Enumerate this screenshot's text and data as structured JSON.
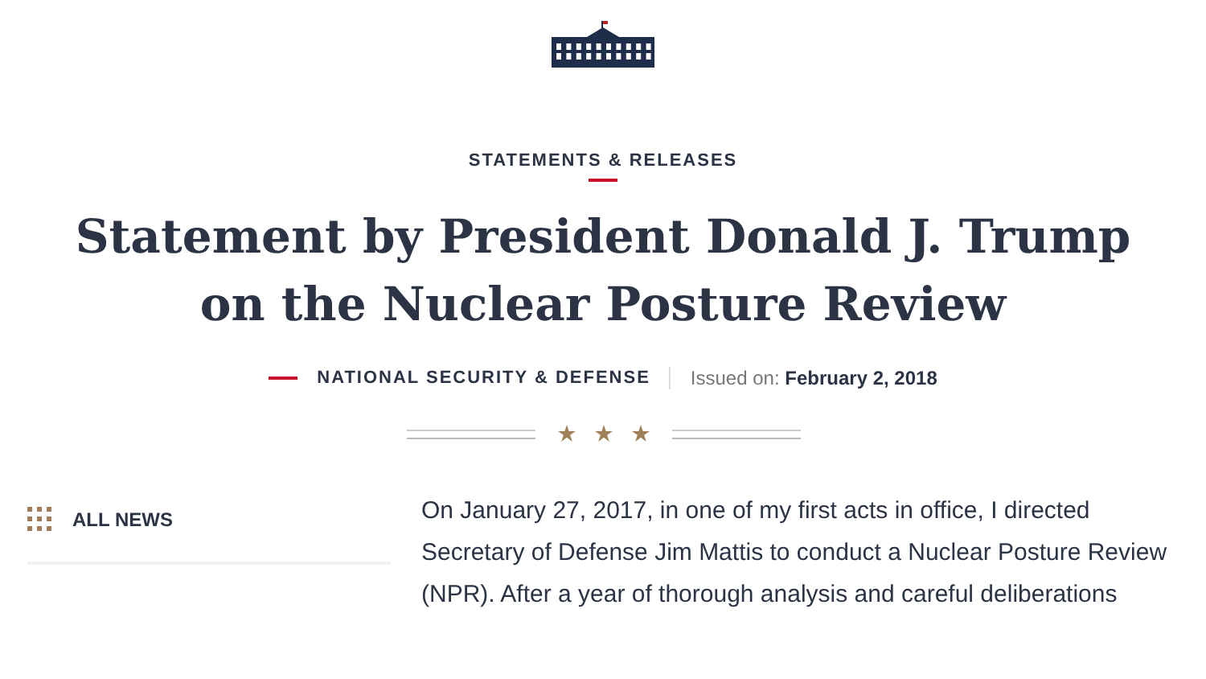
{
  "header": {
    "kind": "logo"
  },
  "category": "STATEMENTS & RELEASES",
  "title": "Statement by President Donald J. Trump on the Nuclear Posture Review",
  "meta": {
    "topic": "NATIONAL SECURITY & DEFENSE",
    "issued_label": "Issued on:",
    "date": "February 2, 2018"
  },
  "divider": {
    "stars": 3
  },
  "sidebar": {
    "link": "ALL NEWS"
  },
  "body": {
    "lines": [
      "On January 27, 2017, in one of my first acts in office, I directed",
      "Secretary of Defense Jim Mattis to conduct a Nuclear Posture Review",
      "(NPR). After a year of thorough analysis and careful deliberations"
    ]
  }
}
